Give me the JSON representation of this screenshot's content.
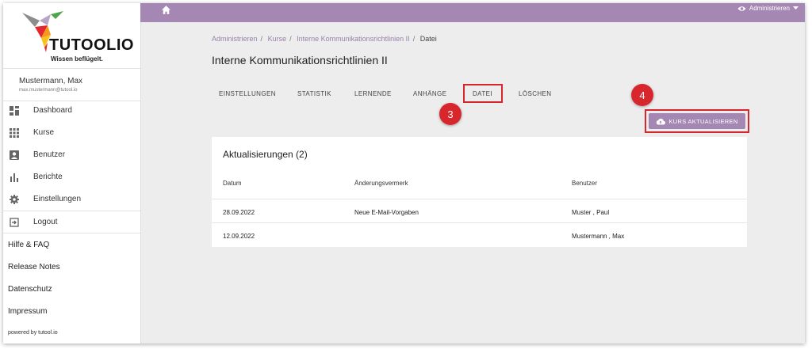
{
  "brand": {
    "name": "TUTOOLIO",
    "tagline": "Wissen beflügelt."
  },
  "user": {
    "name": "Mustermann, Max",
    "email": "max.mustermann@tutool.io"
  },
  "nav": [
    {
      "label": "Dashboard",
      "icon": "dashboard-icon"
    },
    {
      "label": "Kurse",
      "icon": "grid-icon"
    },
    {
      "label": "Benutzer",
      "icon": "user-icon"
    },
    {
      "label": "Berichte",
      "icon": "bar-chart-icon"
    },
    {
      "label": "Einstellungen",
      "icon": "gear-icon"
    },
    {
      "label": "Logout",
      "icon": "logout-icon"
    }
  ],
  "links": [
    "Hilfe & FAQ",
    "Release Notes",
    "Datenschutz",
    "Impressum"
  ],
  "powered": "powered by tutool.io",
  "topbar": {
    "admin_label": "Administrieren"
  },
  "breadcrumb": [
    "Administrieren",
    "Kurse",
    "Interne Kommunikationsrichtlinien II",
    "Datei"
  ],
  "page_title": "Interne Kommunikationsrichtlinien II",
  "tabs": [
    "EINSTELLUNGEN",
    "STATISTIK",
    "LERNENDE",
    "ANHÄNGE",
    "DATEI",
    "LÖSCHEN"
  ],
  "active_tab": "DATEI",
  "markers": {
    "tab": "3",
    "button": "4"
  },
  "update_button": "KURS AKTUALISIEREN",
  "updates": {
    "title": "Aktualisierungen (2)",
    "columns": [
      "Datum",
      "Änderungsvermerk",
      "Benutzer"
    ],
    "rows": [
      {
        "date": "28.09.2022",
        "note": "Neue E-Mail-Vorgaben",
        "user": "Muster , Paul"
      },
      {
        "date": "12.09.2022",
        "note": "",
        "user": "Mustermann , Max"
      }
    ]
  },
  "colors": {
    "accent": "#a587b3",
    "link": "#9a7fa9",
    "highlight": "#d8262d",
    "background": "#ededed"
  }
}
